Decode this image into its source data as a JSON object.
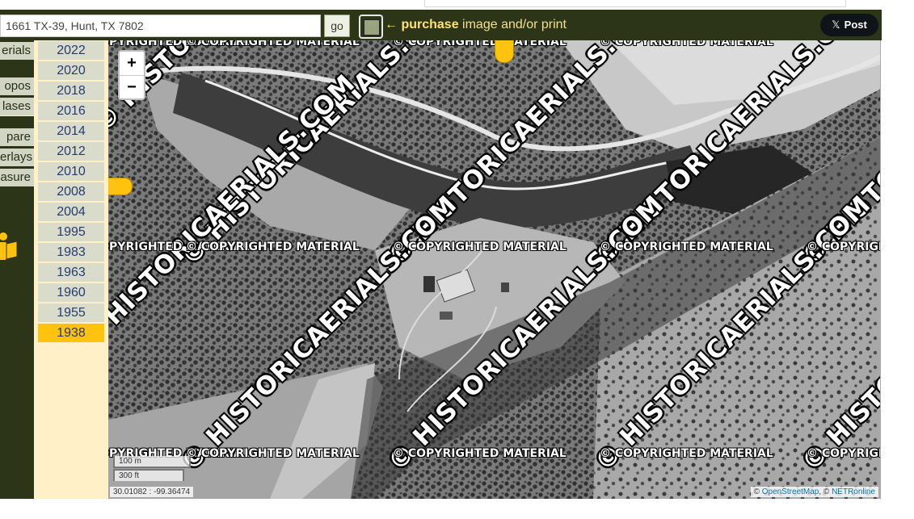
{
  "search": {
    "value": "1661 TX-39, Hunt, TX 7802"
  },
  "go_label": "go",
  "purchase": {
    "strong": "← purchase",
    "rest": " image and/or print"
  },
  "post": {
    "glyph": "𝕏",
    "label": "Post"
  },
  "sidebar": {
    "items": [
      {
        "label": "erials"
      },
      {
        "label": "opos"
      },
      {
        "label": "lases"
      },
      {
        "label": "pare"
      },
      {
        "label": "erlays"
      },
      {
        "label": "asure"
      }
    ],
    "year_badge": "1938"
  },
  "years": [
    "2022",
    "2020",
    "2018",
    "2016",
    "2014",
    "2012",
    "2010",
    "2008",
    "2004",
    "1995",
    "1983",
    "1963",
    "1960",
    "1955",
    "1938"
  ],
  "selected_year": "1938",
  "map": {
    "zoom_in": "+",
    "zoom_out": "−",
    "scale_m": "100 m",
    "scale_ft": "300 ft",
    "coords": "30.01082 : -99.36474",
    "attrib_prefix": "© ",
    "osm": "OpenStreetMap",
    "sep": ", © ",
    "netr": "NETRonline",
    "watermark_text": "© HISTORICAERIALS.COM",
    "copyright_text": "© COPYRIGHTED MATERIAL"
  },
  "colors": {
    "header_bg": "#2c3518",
    "accent_yellow": "#ffc20e",
    "year_button": "#d9dccb",
    "year_panel": "#fff0c7"
  },
  "icons": [
    "purchase-frame-icon",
    "x-logo-icon",
    "person-book-icon",
    "map-pin-icon"
  ]
}
